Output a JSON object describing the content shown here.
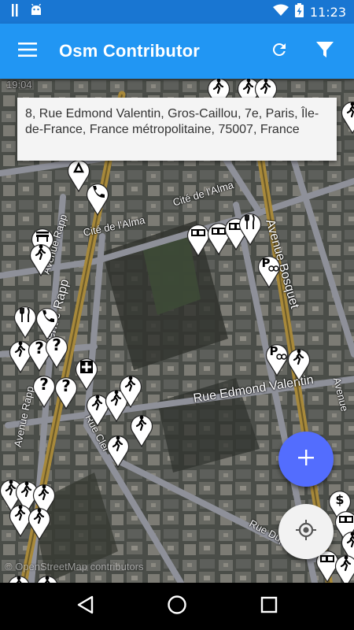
{
  "status_bar": {
    "time": "11:23",
    "icons": [
      "notification-icon",
      "android-icon",
      "wifi-icon",
      "battery-charging-icon"
    ]
  },
  "app_bar": {
    "title": "Osm Contributor",
    "actions": [
      "refresh-icon",
      "filter-icon"
    ]
  },
  "map": {
    "address_popup": "8, Rue Edmond Valentin, Gros-Caillou, 7e, Paris, Île-de-France, France métropolitaine, 75007, France",
    "street_labels": {
      "cite_alma_1": "Cité de l'Alma",
      "cite_alma_2": "Cité de l'Alma",
      "avenue_rapp_top": "Avenue Rapp",
      "avenue_rapp_mid": "Avenue Rapp",
      "avenue_rapp_low": "Avenue Rapp",
      "avenue_bosquet": "Avenue Bosquet",
      "rue_edmond_valentin": "Rue Edmond Valentin",
      "avenue_right": "Avenue",
      "rue_cler": "Rue Cler",
      "rue_dupont": "Rue Dupont",
      "partial_top": "19:04"
    },
    "attribution": "© OpenStreetMap contributors"
  },
  "colors": {
    "status_bar": "#1976D2",
    "app_bar": "#2196F3",
    "fab_add": "#536DFE",
    "fab_locate": "#F2F2F2",
    "main_road": "#A8893A",
    "secondary_road": "#8E9099"
  },
  "fabs": {
    "add": "plus-icon",
    "locate": "gps-locate-icon"
  },
  "nav_bar": [
    "back-icon",
    "home-icon",
    "recents-icon"
  ]
}
